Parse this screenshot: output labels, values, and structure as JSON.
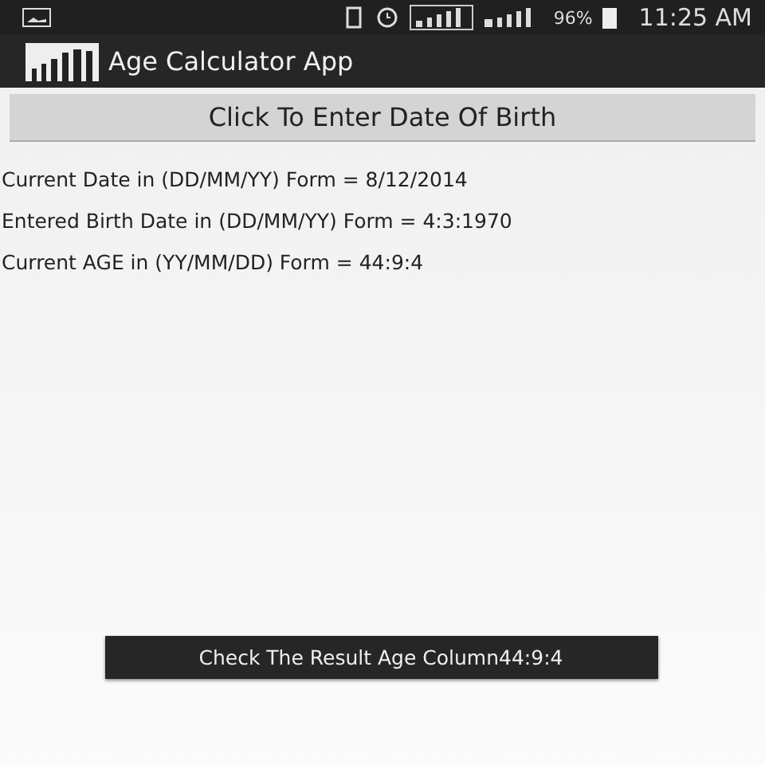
{
  "status_bar": {
    "battery": "96%",
    "time": "11:25 AM"
  },
  "app_bar": {
    "title": "Age Calculator App"
  },
  "enter_button": {
    "label": "Click To Enter Date Of Birth"
  },
  "results": [
    "Current Date in (DD/MM/YY) Form = 8/12/2014",
    "Entered Birth Date in (DD/MM/YY) Form = 4:3:1970",
    "Current AGE in (YY/MM/DD) Form = 44:9:4"
  ],
  "toast": {
    "text": "Check The Result Age Column44:9:4"
  }
}
